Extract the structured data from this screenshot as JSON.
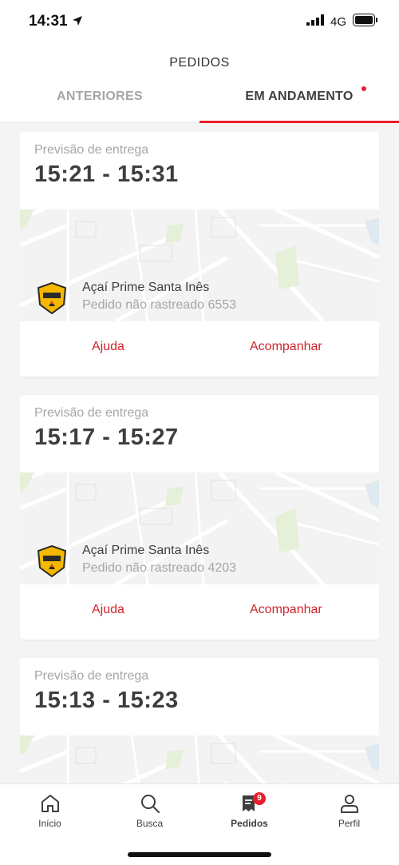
{
  "status_bar": {
    "time": "14:31",
    "network": "4G"
  },
  "header": {
    "title": "PEDIDOS",
    "tabs": [
      {
        "label": "ANTERIORES"
      },
      {
        "label": "EM ANDAMENTO"
      }
    ]
  },
  "orders": [
    {
      "label": "Previsão de entrega",
      "time": "15:21 - 15:31",
      "store": "Açaí Prime Santa Inês",
      "status": "Pedido não rastreado 6553",
      "help": "Ajuda",
      "track": "Acompanhar"
    },
    {
      "label": "Previsão de entrega",
      "time": "15:17 - 15:27",
      "store": "Açaí Prime Santa Inês",
      "status": "Pedido não rastreado 4203",
      "help": "Ajuda",
      "track": "Acompanhar"
    },
    {
      "label": "Previsão de entrega",
      "time": "15:13 - 15:23"
    }
  ],
  "bottom_nav": {
    "items": [
      {
        "label": "Início",
        "icon": "home-icon"
      },
      {
        "label": "Busca",
        "icon": "search-icon"
      },
      {
        "label": "Pedidos",
        "icon": "orders-icon",
        "badge": "9"
      },
      {
        "label": "Perfil",
        "icon": "profile-icon"
      }
    ]
  },
  "colors": {
    "accent": "#ea1d2c",
    "action": "#d2232a",
    "muted": "#a6a6a6",
    "text": "#3e3e3e"
  }
}
